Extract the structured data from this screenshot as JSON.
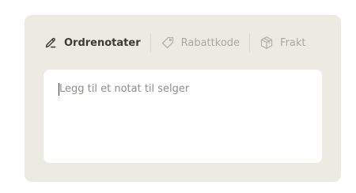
{
  "tabs": [
    {
      "label": "Ordrenotater",
      "icon": "pencil-icon",
      "active": true
    },
    {
      "label": "Rabattkode",
      "icon": "tag-icon",
      "active": false
    },
    {
      "label": "Frakt",
      "icon": "box-icon",
      "active": false
    }
  ],
  "note": {
    "value": "",
    "placeholder": "Legg til et notat til selger"
  },
  "colors": {
    "panel": "#ecebe3",
    "active_text": "#3a3a37",
    "inactive_text": "#a9a89f"
  }
}
